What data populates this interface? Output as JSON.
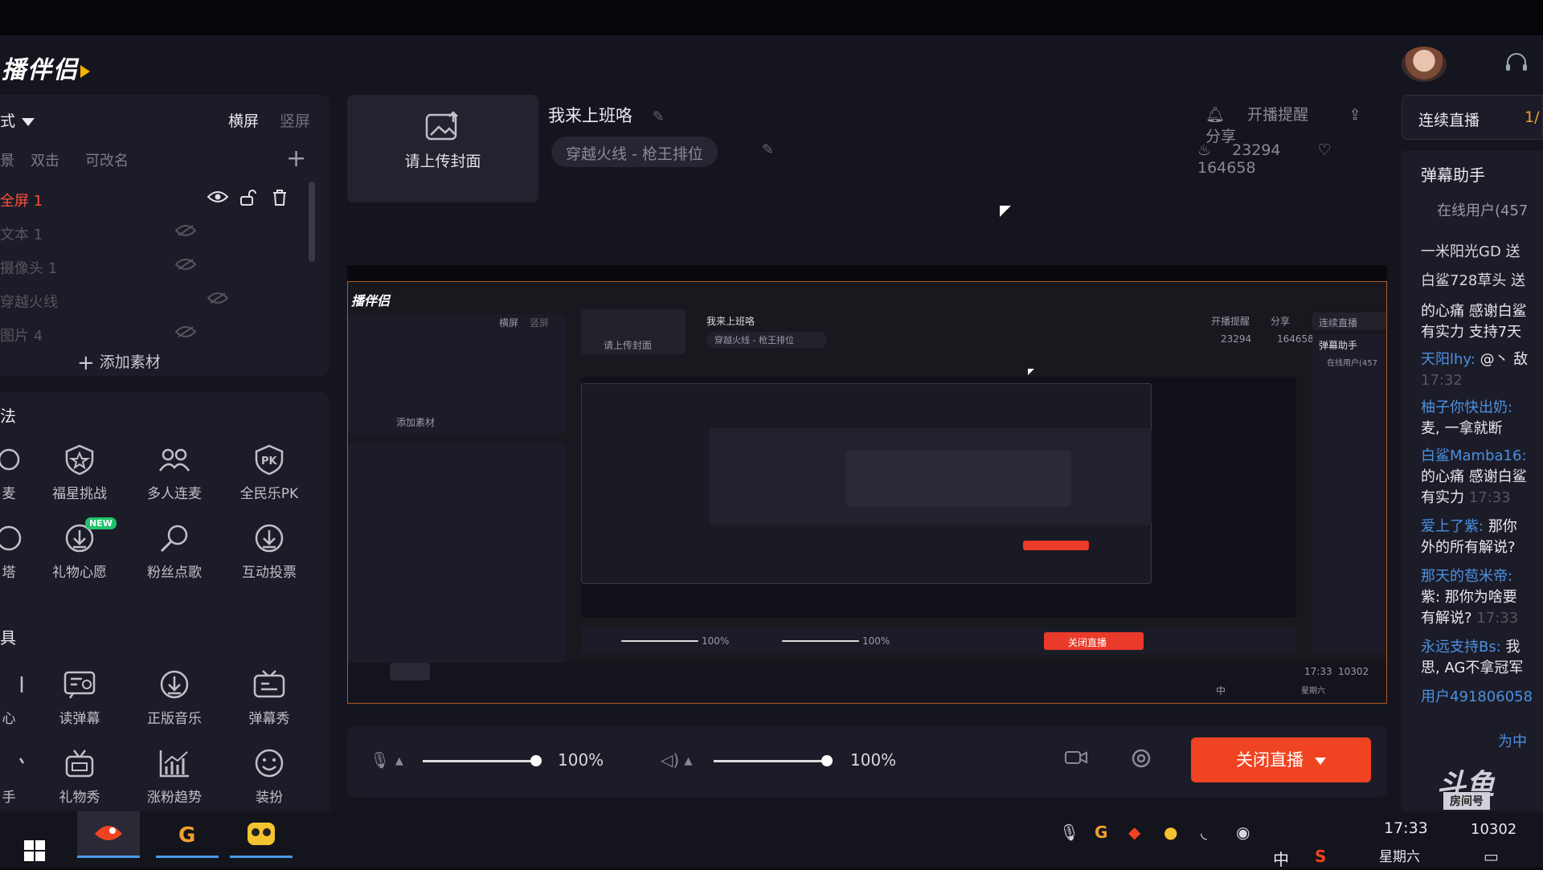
{
  "app": {
    "logo_text": "播伴侣"
  },
  "left_panel": {
    "mode_label": "式",
    "horizontal_label": "横屏",
    "vertical_label": "竖屏",
    "scene_tabs": [
      "景",
      "双击",
      "可改名"
    ],
    "sources": [
      {
        "name": "全屏 1",
        "active": true
      },
      {
        "name": "文本 1",
        "active": false
      },
      {
        "name": "摄像头 1",
        "active": false
      },
      {
        "name": "穿越火线",
        "active": false
      },
      {
        "name": "图片 4",
        "active": false
      }
    ],
    "add_material_label": "添加素材",
    "sections": {
      "play": "法",
      "tools": "具"
    },
    "play_tools": [
      {
        "label": "麦",
        "icon": "mic-link-icon"
      },
      {
        "label": "福星挑战",
        "icon": "star-shield-icon"
      },
      {
        "label": "多人连麦",
        "icon": "multi-link-icon"
      },
      {
        "label": "全民乐PK",
        "icon": "pk-icon"
      },
      {
        "label": "塔",
        "icon": "tower-icon"
      },
      {
        "label": "礼物心愿",
        "icon": "download-gift-icon",
        "badge": "NEW"
      },
      {
        "label": "粉丝点歌",
        "icon": "fan-song-icon"
      },
      {
        "label": "互动投票",
        "icon": "vote-download-icon"
      }
    ],
    "tools": [
      {
        "label": "心",
        "icon": "heart-tool-icon"
      },
      {
        "label": "读弹幕",
        "icon": "read-danmu-icon"
      },
      {
        "label": "正版音乐",
        "icon": "music-download-icon"
      },
      {
        "label": "弹幕秀",
        "icon": "danmu-show-icon"
      },
      {
        "label": "手",
        "icon": "hand-icon"
      },
      {
        "label": "礼物秀",
        "icon": "gift-show-icon"
      },
      {
        "label": "涨粉趋势",
        "icon": "trend-chart-icon"
      },
      {
        "label": "装扮",
        "icon": "smile-icon"
      }
    ]
  },
  "stream": {
    "upload_cover_label": "请上传封面",
    "title": "我来上班咯",
    "category": "穿越火线 - 枪王排位",
    "remind_label": "开播提醒",
    "share_label": "分享",
    "hot_count": "23294",
    "like_count": "164658"
  },
  "controls": {
    "mic_volume": "100%",
    "speaker_volume": "100%",
    "stop_button_label": "关闭直播"
  },
  "right_panel": {
    "continuous_label": "连续直播",
    "page": "1/",
    "danmu_title": "弹幕助手",
    "online_users": "在线用户(457",
    "messages": [
      {
        "user": "",
        "text": "一米阳光GD 送",
        "time": ""
      },
      {
        "user": "",
        "text": "白鲨728草头 送",
        "time": ""
      },
      {
        "user": "",
        "text": "的心痛 感谢白鲨",
        "time": ""
      },
      {
        "user": "",
        "text": "有实力 支持7天",
        "time": ""
      },
      {
        "user": "天阳lhy:",
        "text": "@丶 敌",
        "time": ""
      },
      {
        "user": "",
        "text": "",
        "time": "17:32"
      },
      {
        "user": "柚子你快出奶:",
        "text": "",
        "time": ""
      },
      {
        "user": "",
        "text": "麦, 一拿就断",
        "time": ""
      },
      {
        "user": "白鲨Mamba16:",
        "text": "",
        "time": ""
      },
      {
        "user": "",
        "text": "的心痛 感谢白鲨",
        "time": ""
      },
      {
        "user": "",
        "text": "有实力",
        "time": "17:33"
      },
      {
        "user": "爱上了紫:",
        "text": "那你",
        "time": ""
      },
      {
        "user": "",
        "text": "外的所有解说?",
        "time": ""
      },
      {
        "user": "那天的苞米帝:",
        "text": "",
        "time": ""
      },
      {
        "user": "",
        "text": "紫: 那你为啥要",
        "time": ""
      },
      {
        "user": "",
        "text": "有解说?",
        "time": "17:33"
      },
      {
        "user": "永远支持Bs:",
        "text": "我",
        "time": ""
      },
      {
        "user": "",
        "text": "思, AG不拿冠军",
        "time": ""
      },
      {
        "user": "用户491806058",
        "text": "",
        "time": ""
      },
      {
        "user": "",
        "text": "为中",
        "time": ""
      }
    ],
    "douyu_logo": "斗鱼",
    "room_label": "房间号"
  },
  "taskbar": {
    "time": "17:33",
    "room_number": "10302",
    "weekday": "星期六",
    "ime": "中"
  },
  "preview_nested": {
    "logo": "播伴侣",
    "title": "我来上班咯",
    "category": "穿越火线 - 枪王排位",
    "upload": "请上传封面",
    "hot": "23294",
    "like": "164658",
    "stop": "关闭直播",
    "vol1": "100%",
    "vol2": "100%",
    "danmu": "弹幕助手",
    "online": "在线用户(457",
    "continuous": "连续直播",
    "time": "17:33",
    "room": "10302",
    "weekday": "星期六",
    "ime": "中",
    "add": "添加素材",
    "remind": "开播提醒",
    "share": "分享",
    "screen_h": "横屏",
    "screen_v": "竖屏"
  },
  "colors": {
    "accent_red": "#f04321",
    "background": "#15151f",
    "panel": "#1c1c28",
    "active_source": "#ff4e3a",
    "danmu_user": "#4a90e2",
    "new_badge": "#1fc26a"
  }
}
